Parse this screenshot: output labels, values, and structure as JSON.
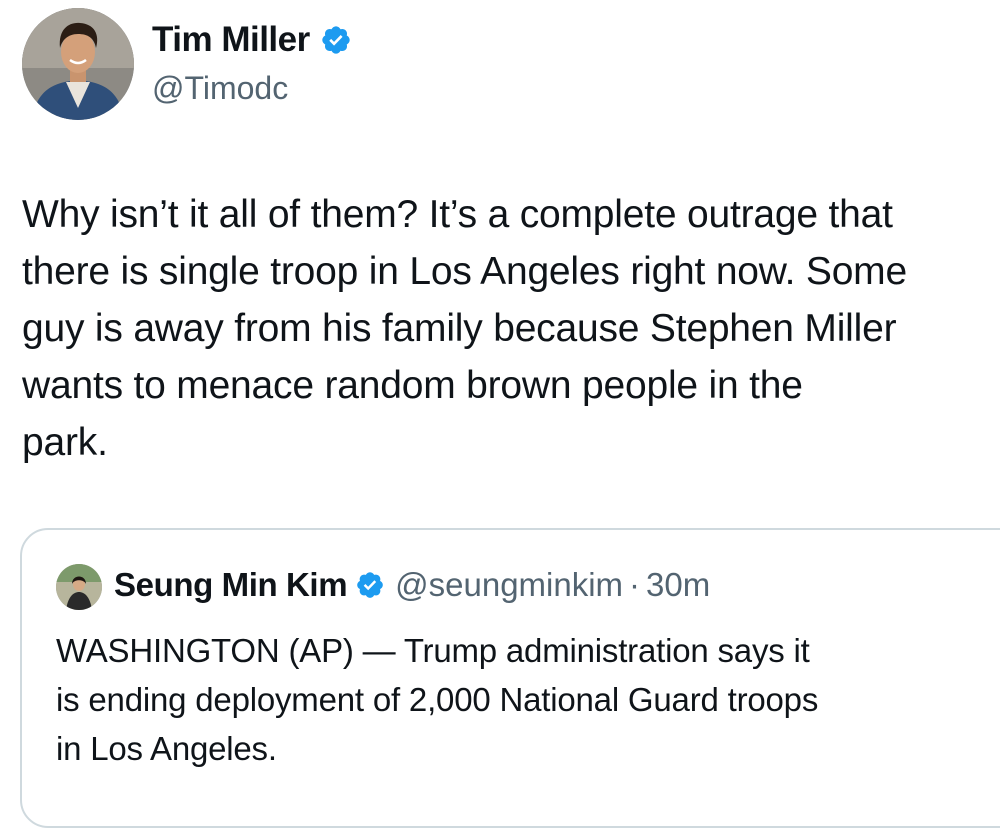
{
  "author": {
    "display_name": "Tim Miller",
    "handle": "@Timodc",
    "verified_icon": "verified-badge-icon"
  },
  "tweet": {
    "text": "Why isn’t it all of them? It’s a complete outrage that\nthere is single troop in Los Angeles right now. Some\nguy is away from his family because Stephen Miller\nwants to menace random brown people in the\npark."
  },
  "quoted_tweet": {
    "display_name": "Seung Min Kim",
    "handle": "@seungminkim",
    "separator": "·",
    "time": "30m",
    "text": "WASHINGTON (AP) — Trump administration says it\nis ending deployment of 2,000 National Guard troops\nin Los Angeles."
  },
  "colors": {
    "verified_blue": "#1d9bf0",
    "secondary_text": "#536471",
    "card_border": "#cfd9de"
  }
}
